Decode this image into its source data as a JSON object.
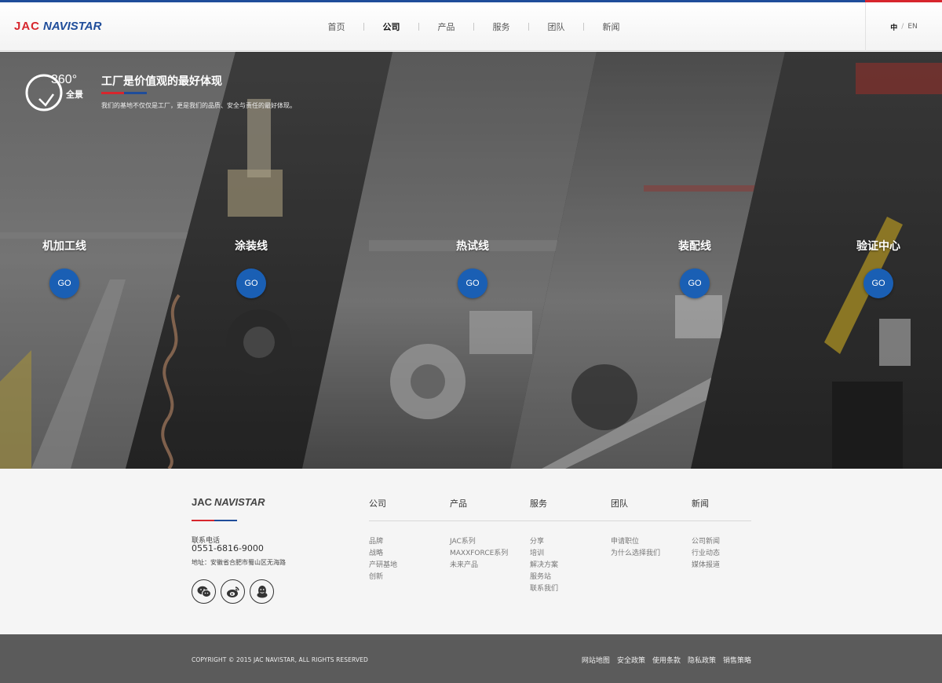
{
  "header": {
    "logo": {
      "jac": "JAC",
      "navistar": "NAVISTAR"
    },
    "nav": [
      {
        "label": "首页",
        "active": false
      },
      {
        "label": "公司",
        "active": true
      },
      {
        "label": "产品",
        "active": false
      },
      {
        "label": "服务",
        "active": false
      },
      {
        "label": "团队",
        "active": false
      },
      {
        "label": "新闻",
        "active": false
      }
    ],
    "lang": {
      "current": "中",
      "separator": "/",
      "other": "EN"
    }
  },
  "hero": {
    "icon": {
      "degrees": "360°",
      "label": "全景",
      "name": "panorama-360-icon"
    },
    "title": "工厂是价值观的最好体现",
    "description": "我们的基地不仅仅是工厂，更是我们的品质、安全与责任的最好体现。",
    "panels": [
      {
        "label": "机加工线",
        "button": "GO"
      },
      {
        "label": "涂装线",
        "button": "GO"
      },
      {
        "label": "热试线",
        "button": "GO"
      },
      {
        "label": "装配线",
        "button": "GO"
      },
      {
        "label": "验证中心",
        "button": "GO"
      }
    ]
  },
  "footer": {
    "logo": {
      "jac": "JAC",
      "navistar": "NAVISTAR"
    },
    "phone_label": "联系电话",
    "phone": "0551-6816-9000",
    "address": "地址：安徽省合肥市蜀山区无海路",
    "social_icons": [
      "wechat-icon",
      "weibo-icon",
      "qq-icon"
    ],
    "columns": [
      {
        "title": "公司",
        "items": [
          "品牌",
          "战略",
          "产研基地",
          "创新"
        ]
      },
      {
        "title": "产品",
        "items": [
          "JAC系列",
          "MAXXFORCE系列",
          "未来产品"
        ]
      },
      {
        "title": "服务",
        "items": [
          "分享",
          "培训",
          "解决方案",
          "服务站",
          "联系我们"
        ]
      },
      {
        "title": "团队",
        "items": [
          "申请职位",
          "为什么选择我们"
        ]
      },
      {
        "title": "新闻",
        "items": [
          "公司新闻",
          "行业动态",
          "媒体报道"
        ]
      }
    ],
    "copyright": "COPYRIGHT © 2015 JAC NAVISTAR, ALL RIGHTS RESERVED",
    "bottom_links": [
      "网站地图",
      "安全政策",
      "使用条款",
      "隐私政策",
      "销售策略"
    ]
  },
  "colors": {
    "brand_blue": "#1f4d9a",
    "brand_red": "#d7262d",
    "go_button": "#1a5fb4",
    "footer_bottom": "#5b5b5b"
  }
}
